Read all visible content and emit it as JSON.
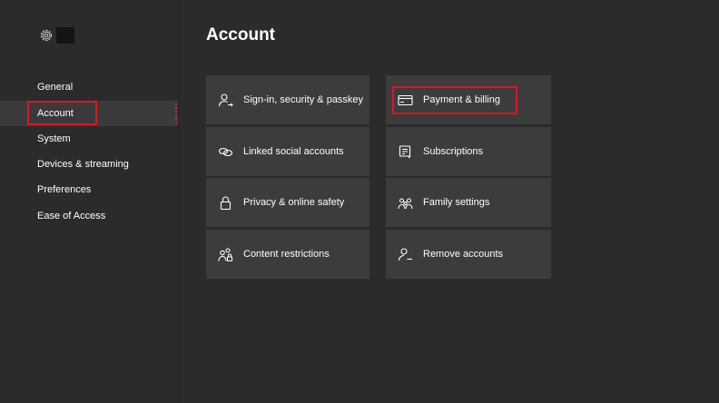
{
  "sidebar": {
    "items": [
      {
        "label": "General"
      },
      {
        "label": "Account"
      },
      {
        "label": "System"
      },
      {
        "label": "Devices & streaming"
      },
      {
        "label": "Preferences"
      },
      {
        "label": "Ease of Access"
      }
    ],
    "selected": "Account"
  },
  "main": {
    "title": "Account",
    "tiles": [
      {
        "label": "Sign-in, security & passkey",
        "icon": "person-key-icon"
      },
      {
        "label": "Payment & billing",
        "icon": "credit-card-icon"
      },
      {
        "label": "Linked social accounts",
        "icon": "link-icon"
      },
      {
        "label": "Subscriptions",
        "icon": "subscriptions-icon"
      },
      {
        "label": "Privacy & online safety",
        "icon": "lock-icon"
      },
      {
        "label": "Family settings",
        "icon": "family-icon"
      },
      {
        "label": "Content restrictions",
        "icon": "content-restrictions-icon"
      },
      {
        "label": "Remove accounts",
        "icon": "person-remove-icon"
      }
    ]
  },
  "colors": {
    "background": "#2b2b2b",
    "tile": "#3c3c3c",
    "highlight": "#e0141e",
    "text": "#ffffff"
  }
}
